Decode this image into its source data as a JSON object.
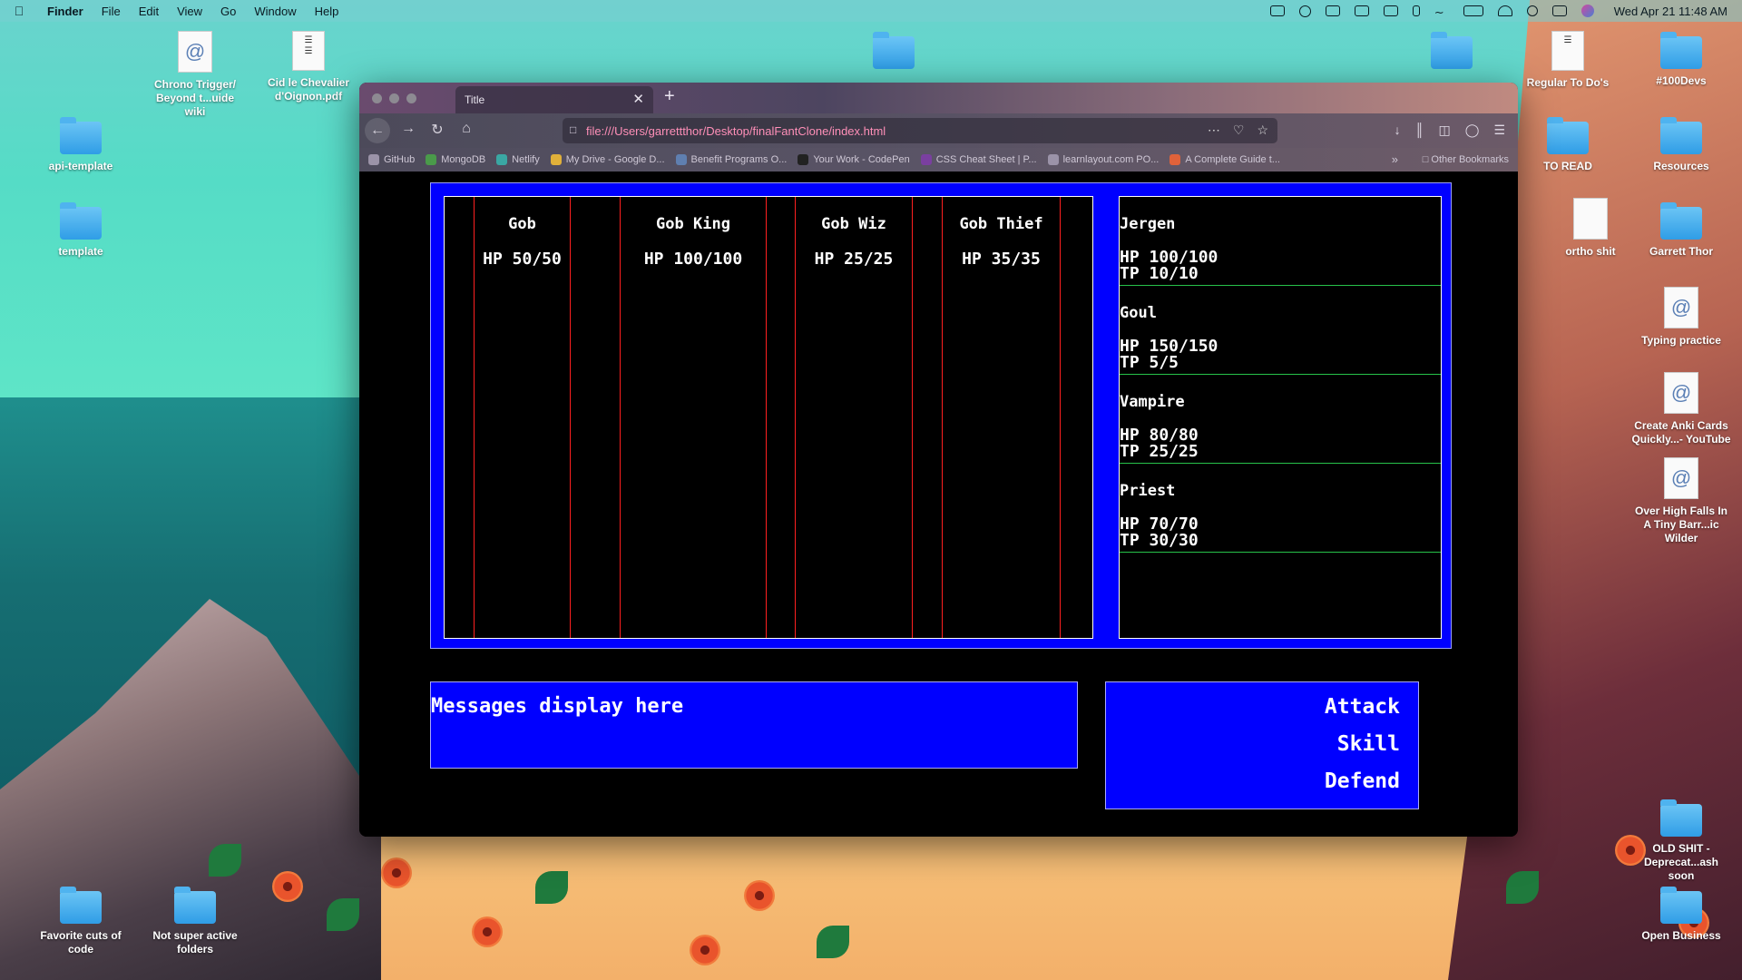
{
  "menubar": {
    "app": "Finder",
    "items": [
      "File",
      "Edit",
      "View",
      "Go",
      "Window",
      "Help"
    ],
    "clock": "Wed Apr 21  11:48 AM"
  },
  "desktop": {
    "icons": [
      {
        "label": "Chrono Trigger/ Beyond t...uide wiki",
        "kind": "doc"
      },
      {
        "label": "Cid le Chevalier d'Oignon.pdf",
        "kind": "pdf"
      },
      {
        "label": "api-template",
        "kind": "folder"
      },
      {
        "label": "template",
        "kind": "folder"
      },
      {
        "label": "Regular To Do's",
        "kind": "doc"
      },
      {
        "label": "#100Devs",
        "kind": "folder"
      },
      {
        "label": "TO READ",
        "kind": "folder"
      },
      {
        "label": "Resources",
        "kind": "folder"
      },
      {
        "label": "ortho shit",
        "kind": "doc"
      },
      {
        "label": "Garrett Thor",
        "kind": "folder"
      },
      {
        "label": "Typing practice",
        "kind": "doc"
      },
      {
        "label": "Create Anki Cards Quickly...- YouTube",
        "kind": "doc"
      },
      {
        "label": "Over High Falls In A Tiny Barr...ic Wilder",
        "kind": "doc"
      },
      {
        "label": "OLD SHIT - Deprecat...ash soon",
        "kind": "folder"
      },
      {
        "label": "Open Business",
        "kind": "folder"
      },
      {
        "label": "Favorite cuts of code",
        "kind": "folder"
      },
      {
        "label": "Not super active folders",
        "kind": "folder"
      }
    ]
  },
  "browser": {
    "tab_title": "Title",
    "url": "file:///Users/garrettthor/Desktop/finalFantClone/index.html",
    "bookmarks": [
      "GitHub",
      "MongoDB",
      "Netlify",
      "My Drive - Google D...",
      "Benefit Programs O...",
      "Your Work - CodePen",
      "CSS Cheat Sheet | P...",
      "learnlayout.com PO...",
      "A Complete Guide t..."
    ],
    "other_bookmarks": "Other Bookmarks"
  },
  "game": {
    "enemies": [
      {
        "name": "Gob",
        "hp": "HP 50/50"
      },
      {
        "name": "Gob King",
        "hp": "HP 100/100"
      },
      {
        "name": "Gob Wiz",
        "hp": "HP 25/25"
      },
      {
        "name": "Gob Thief",
        "hp": "HP 35/35"
      }
    ],
    "party": [
      {
        "name": "Jergen",
        "hp": "HP 100/100",
        "tp": "TP 10/10"
      },
      {
        "name": "Goul",
        "hp": "HP 150/150",
        "tp": "TP 5/5"
      },
      {
        "name": "Vampire",
        "hp": "HP 80/80",
        "tp": "TP 25/25"
      },
      {
        "name": "Priest",
        "hp": "HP 70/70",
        "tp": "TP 30/30"
      }
    ],
    "message": "Messages display here",
    "actions": {
      "attack": "Attack",
      "skill": "Skill",
      "defend": "Defend"
    }
  },
  "colors": {
    "panel_blue": "#0000ff",
    "enemy_divider": "#ff2020",
    "party_divider": "#27c24a",
    "url_text": "#ff8fb8"
  }
}
